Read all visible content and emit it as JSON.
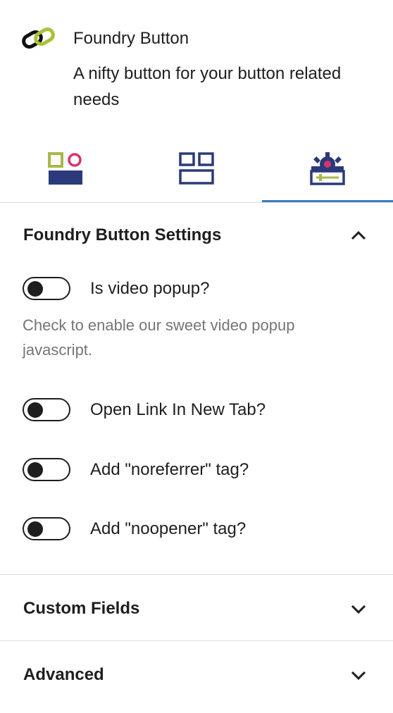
{
  "block": {
    "title": "Foundry Button",
    "description": "A nifty button for your button related needs",
    "icon": "chain-link-icon"
  },
  "tabs": [
    {
      "name": "styles-tab",
      "icon": "styles-icon"
    },
    {
      "name": "layout-tab",
      "icon": "layout-icon"
    },
    {
      "name": "settings-tab",
      "icon": "settings-icon",
      "active": true
    }
  ],
  "panels": {
    "settings": {
      "title": "Foundry Button Settings",
      "expanded": true,
      "toggles": [
        {
          "label": "Is video popup?",
          "checked": false
        },
        {
          "label": "Open Link In New Tab?",
          "checked": false
        },
        {
          "label": "Add \"noreferrer\" tag?",
          "checked": false
        },
        {
          "label": "Add \"noopener\" tag?",
          "checked": false
        }
      ],
      "help": "Check to enable our sweet video popup javascript."
    },
    "custom_fields": {
      "title": "Custom Fields",
      "expanded": false
    },
    "advanced": {
      "title": "Advanced",
      "expanded": false
    }
  },
  "colors": {
    "accent": "#3e7bb8",
    "navy": "#2b3a7a",
    "olive": "#a8b84a",
    "pink": "#d6336c"
  }
}
